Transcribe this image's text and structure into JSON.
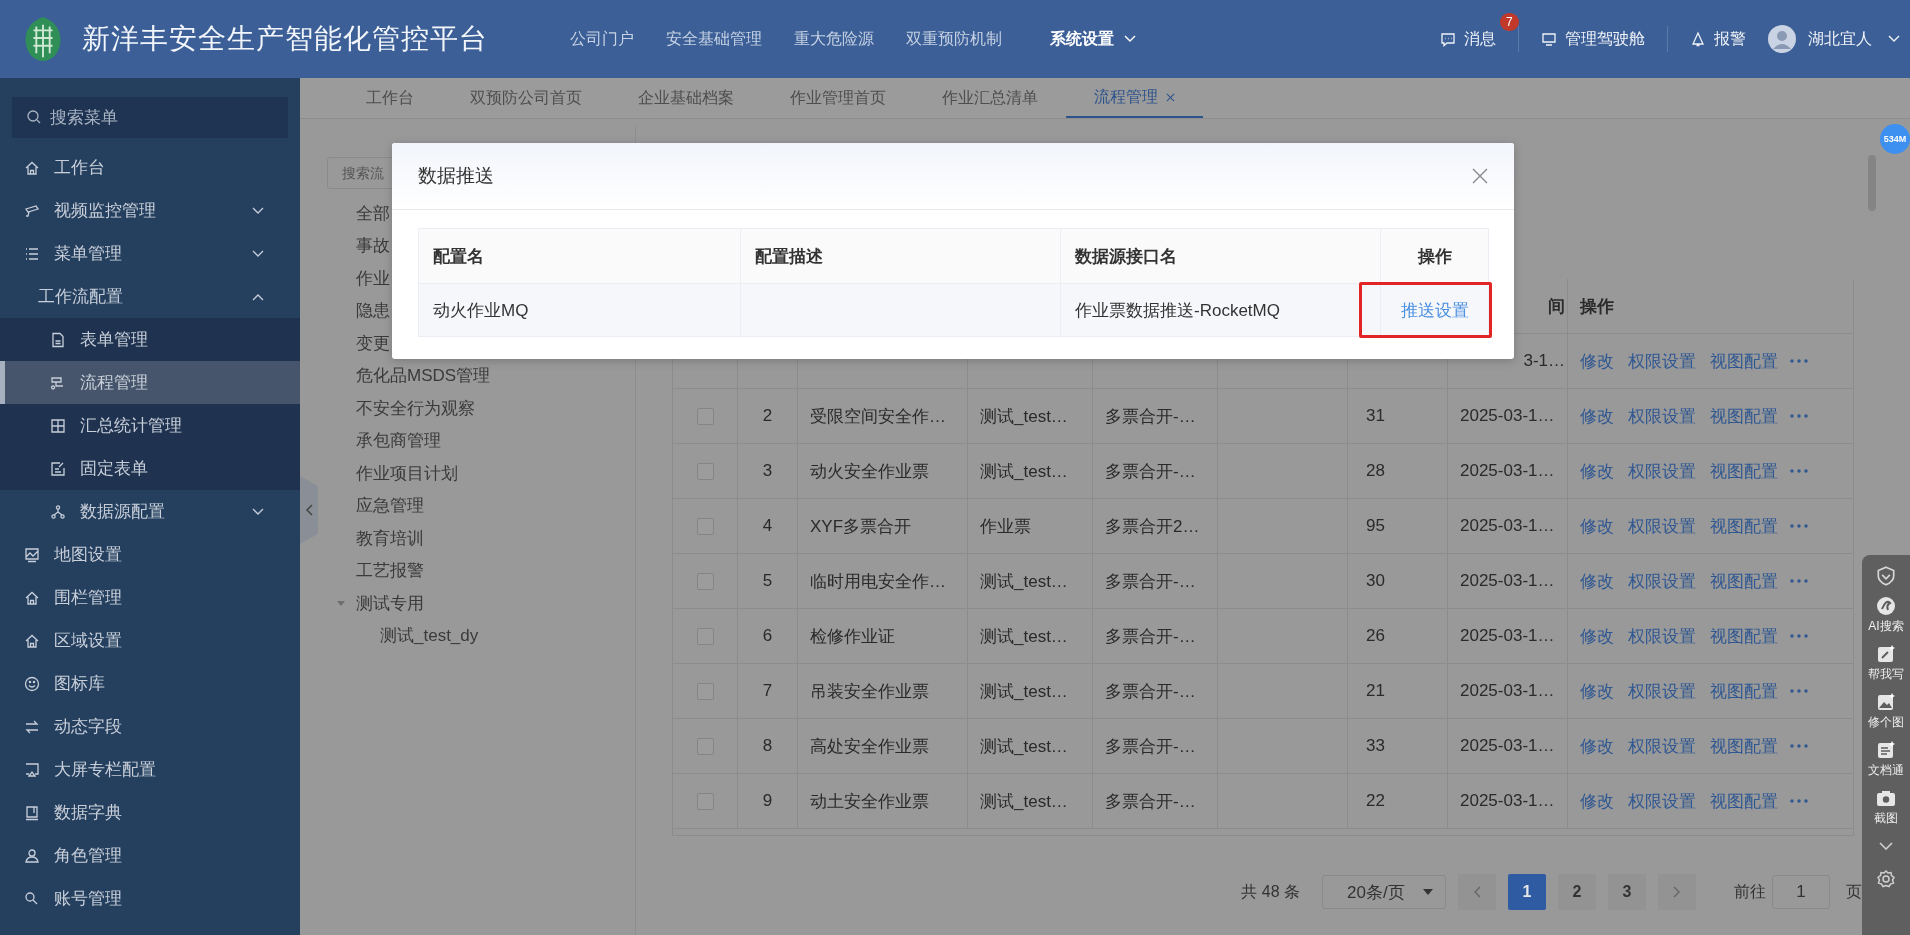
{
  "header": {
    "title": "新洋丰安全生产智能化管控平台",
    "nav": [
      {
        "label": "公司门户",
        "selected": false
      },
      {
        "label": "安全基础管理",
        "selected": false
      },
      {
        "label": "重大危险源",
        "selected": false
      },
      {
        "label": "双重预防机制",
        "selected": false
      },
      {
        "label": "系统设置",
        "selected": true
      }
    ],
    "messages": {
      "label": "消息",
      "badge": "7"
    },
    "cockpit": "管理驾驶舱",
    "alarm": "报警",
    "user": "湖北宜人"
  },
  "sidebar": {
    "search_placeholder": "搜索菜单",
    "items": [
      {
        "label": "工作台",
        "selected": false
      },
      {
        "label": "视频监控管理",
        "selected": false,
        "expanded": false
      },
      {
        "label": "菜单管理",
        "selected": false,
        "expanded": false
      },
      {
        "label": "工作流配置",
        "selected": false,
        "expanded": true,
        "children": [
          {
            "label": "表单管理",
            "selected": false
          },
          {
            "label": "流程管理",
            "selected": true
          },
          {
            "label": "汇总统计管理",
            "selected": false
          },
          {
            "label": "固定表单",
            "selected": false
          },
          {
            "label": "数据源配置",
            "selected": false,
            "expanded": false
          }
        ]
      },
      {
        "label": "地图设置",
        "selected": false
      },
      {
        "label": "围栏管理",
        "selected": false
      },
      {
        "label": "区域设置",
        "selected": false
      },
      {
        "label": "图标库",
        "selected": false
      },
      {
        "label": "动态字段",
        "selected": false
      },
      {
        "label": "大屏专栏配置",
        "selected": false
      },
      {
        "label": "数据字典",
        "selected": false
      },
      {
        "label": "角色管理",
        "selected": false
      },
      {
        "label": "账号管理",
        "selected": false
      }
    ]
  },
  "tabs": [
    {
      "label": "工作台",
      "selected": false,
      "closable": false
    },
    {
      "label": "双预防公司首页",
      "selected": false,
      "closable": false
    },
    {
      "label": "企业基础档案",
      "selected": false,
      "closable": false
    },
    {
      "label": "作业管理首页",
      "selected": false,
      "closable": false
    },
    {
      "label": "作业汇总清单",
      "selected": false,
      "closable": false
    },
    {
      "label": "流程管理",
      "selected": true,
      "closable": true
    }
  ],
  "tree": {
    "search_placeholder": "搜索流",
    "items": [
      {
        "label": "全部"
      },
      {
        "label": "事故"
      },
      {
        "label": "作业"
      },
      {
        "label": "隐患"
      },
      {
        "label": "变更"
      },
      {
        "label": "危化品MSDS管理"
      },
      {
        "label": "不安全行为观察"
      },
      {
        "label": "承包商管理"
      },
      {
        "label": "作业项目计划"
      },
      {
        "label": "应急管理"
      },
      {
        "label": "教育培训"
      },
      {
        "label": "工艺报警"
      },
      {
        "label": "测试专用",
        "expanded": true,
        "children": [
          {
            "label": "测试_test_dy"
          }
        ]
      }
    ]
  },
  "table": {
    "columns": [
      {
        "kind": "check"
      },
      {
        "kind": "index"
      },
      {
        "kind": "name"
      },
      {
        "kind": "category"
      },
      {
        "kind": "column_5"
      },
      {
        "kind": "column_6"
      },
      {
        "kind": "count"
      },
      {
        "kind": "date",
        "label": "间"
      },
      {
        "kind": "actions",
        "label": "操作"
      }
    ],
    "rows": [
      {
        "date": "3-1…",
        "actions": [
          "修改",
          "权限设置",
          "视图配置"
        ]
      },
      {
        "checked": false,
        "index": "2",
        "name": "受限空间安全作…",
        "category": "测试_test…",
        "column_5": "多票合开-…",
        "count": "31",
        "date": "2025-03-1…",
        "actions": [
          "修改",
          "权限设置",
          "视图配置"
        ]
      },
      {
        "checked": false,
        "index": "3",
        "name": "动火安全作业票",
        "category": "测试_test…",
        "column_5": "多票合开-…",
        "count": "28",
        "date": "2025-03-1…",
        "actions": [
          "修改",
          "权限设置",
          "视图配置"
        ]
      },
      {
        "checked": false,
        "index": "4",
        "name": "XYF多票合开",
        "category": "作业票",
        "column_5": "多票合开2…",
        "count": "95",
        "date": "2025-03-1…",
        "actions": [
          "修改",
          "权限设置",
          "视图配置"
        ]
      },
      {
        "checked": false,
        "index": "5",
        "name": "临时用电安全作…",
        "category": "测试_test…",
        "column_5": "多票合开-…",
        "count": "30",
        "date": "2025-03-1…",
        "actions": [
          "修改",
          "权限设置",
          "视图配置"
        ]
      },
      {
        "checked": false,
        "index": "6",
        "name": "检修作业证",
        "category": "测试_test…",
        "column_5": "多票合开-…",
        "count": "26",
        "date": "2025-03-1…",
        "actions": [
          "修改",
          "权限设置",
          "视图配置"
        ]
      },
      {
        "checked": false,
        "index": "7",
        "name": "吊装安全作业票",
        "category": "测试_test…",
        "column_5": "多票合开-…",
        "count": "21",
        "date": "2025-03-1…",
        "actions": [
          "修改",
          "权限设置",
          "视图配置"
        ]
      },
      {
        "checked": false,
        "index": "8",
        "name": "高处安全作业票",
        "category": "测试_test…",
        "column_5": "多票合开-…",
        "count": "33",
        "date": "2025-03-1…",
        "actions": [
          "修改",
          "权限设置",
          "视图配置"
        ]
      },
      {
        "checked": false,
        "index": "9",
        "name": "动土安全作业票",
        "category": "测试_test…",
        "column_5": "多票合开-…",
        "count": "22",
        "date": "2025-03-1…",
        "actions": [
          "修改",
          "权限设置",
          "视图配置"
        ]
      }
    ]
  },
  "pagination": {
    "total": "共 48 条",
    "page_size": "20条/页",
    "pages": [
      {
        "label": "1",
        "selected": true
      },
      {
        "label": "2",
        "selected": false
      },
      {
        "label": "3",
        "selected": false
      }
    ],
    "goto_label": "前往",
    "goto_value": "1",
    "goto_suffix": "页"
  },
  "dialog": {
    "title": "数据推送",
    "columns": [
      "配置名",
      "配置描述",
      "数据源接口名",
      "操作"
    ],
    "rows": [
      {
        "name": "动火作业MQ",
        "interface": "作业票数据推送-RocketMQ",
        "action": "推送设置",
        "highlighted": true
      }
    ]
  },
  "memory_badge": "534M",
  "side_tools": [
    {
      "kind": "shield"
    },
    {
      "kind": "ai",
      "label": "AI搜索"
    },
    {
      "kind": "write",
      "label": "帮我写"
    },
    {
      "kind": "photo",
      "label": "修个图"
    },
    {
      "kind": "docs",
      "label": "文档通"
    },
    {
      "kind": "camera",
      "label": "截图"
    },
    {
      "kind": "chevron"
    },
    {
      "kind": "gear"
    }
  ]
}
